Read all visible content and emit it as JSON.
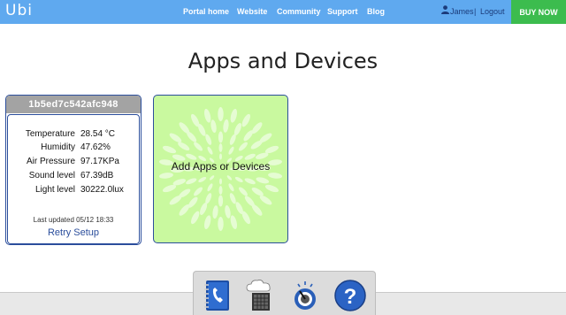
{
  "app": {
    "logo": "Ubi"
  },
  "nav": {
    "portal_home": "Portal home",
    "website": "Website",
    "community": "Community",
    "support": "Support",
    "blog": "Blog"
  },
  "user": {
    "name": "James",
    "separator": "|",
    "logout": "Logout"
  },
  "buy_now": "BUY NOW",
  "page_title": "Apps and Devices",
  "device": {
    "id": "1b5ed7c542afc948",
    "readings": [
      {
        "label": "Temperature",
        "value": "28.54 °C"
      },
      {
        "label": "Humidity",
        "value": "47.62%"
      },
      {
        "label": "Air Pressure",
        "value": "97.17KPa"
      },
      {
        "label": "Sound level",
        "value": "67.39dB"
      },
      {
        "label": "Light level",
        "value": "30222.0lux"
      }
    ],
    "last_updated": "Last updated 05/12 18:33",
    "retry": "Retry Setup"
  },
  "add_card": {
    "label": "Add Apps or Devices"
  },
  "dock": {
    "icons": [
      "phone-book-icon",
      "cloud-speaker-icon",
      "gauge-dial-icon",
      "help-icon"
    ],
    "help_glyph": "?"
  },
  "colors": {
    "topbar": "#5fa9ef",
    "buy_now": "#3cbc4e",
    "add_card": "#c9f99f",
    "border": "#2b4e9c",
    "device_header": "#a3a3a3"
  }
}
